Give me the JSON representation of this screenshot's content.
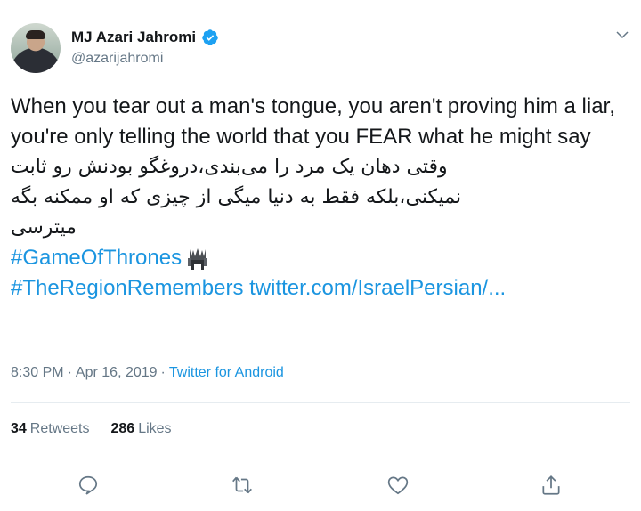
{
  "author": {
    "display_name": "MJ Azari Jahromi",
    "handle": "@azarijahromi",
    "verified": true,
    "verified_color": "#1da1f2"
  },
  "tweet": {
    "text_en": "When you tear out a man's tongue, you aren't proving him a liar, you're only telling the world that you FEAR what he might say",
    "text_fa_line1": "وقتی دهان یک مرد را می‌بندی،دروغگو بودنش رو ثابت",
    "text_fa_line2": "نمیکنی،بلکه فقط به دنیا میگی از چیزی که او ممکنه بگه",
    "text_fa_line3": "میترسی",
    "hashtag1": "#GameOfThrones",
    "hashtag2_and_link": "#TheRegionRemembers twitter.com/IsraelPersian/...",
    "link_color": "#1b95e0"
  },
  "meta": {
    "time": "8:30 PM",
    "date": "Apr 16, 2019",
    "separator": "·",
    "source": "Twitter for Android"
  },
  "stats": {
    "retweets_count": "34",
    "retweets_label": "Retweets",
    "likes_count": "286",
    "likes_label": "Likes"
  },
  "icons": {
    "caret": "chevron-down-icon",
    "reply": "reply-icon",
    "retweet": "retweet-icon",
    "like": "heart-icon",
    "share": "share-icon",
    "emoji": "throne-emoji-icon"
  }
}
